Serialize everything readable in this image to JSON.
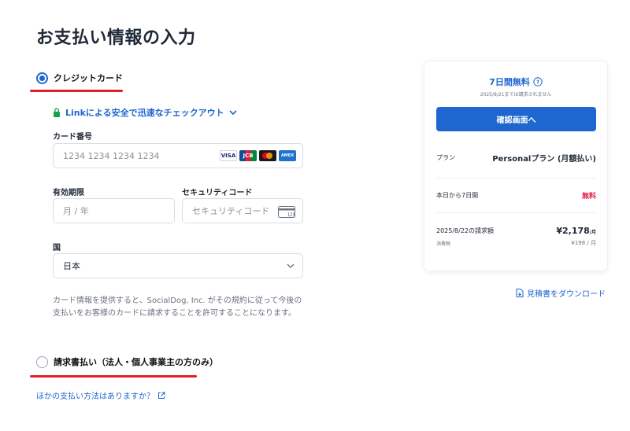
{
  "page": {
    "title": "お支払い情報の入力"
  },
  "payment_methods": {
    "credit_card": {
      "label": "クレジットカード",
      "selected": true
    },
    "invoice": {
      "label": "請求書払い（法人・個人事業主の方のみ）",
      "selected": false
    }
  },
  "link_checkout": {
    "label": "Linkによる安全で迅速なチェックアウト"
  },
  "card_form": {
    "card_number_label": "カード番号",
    "card_number_placeholder": "1234 1234 1234 1234",
    "brands": [
      "VISA",
      "JCB",
      "Mastercard",
      "AMEX"
    ],
    "expiry_label": "有効期限",
    "expiry_placeholder": "月 / 年",
    "cvc_label": "セキュリティコード",
    "cvc_placeholder": "セキュリティコード",
    "cvc_icon_text": "123",
    "country_label": "国",
    "country_value": "日本"
  },
  "disclaimer": "カード情報を提供すると、SocialDog, Inc. がその規約に従って今後の支払いをお客様のカードに請求することを許可することになります。",
  "other_methods_link": "ほかの支払い方法はありますか？",
  "summary": {
    "trial_title": "7日間無料",
    "trial_subtitle": "2025/8/21までは請求されません",
    "confirm_button": "確認画面へ",
    "plan_label": "プラン",
    "plan_value": "Personalプラン (月額払い)",
    "trial_row_label": "本日から7日間",
    "trial_row_value": "無料",
    "billing_label": "2025/8/22の請求額",
    "billing_amount": "¥2,178",
    "billing_unit": "/月",
    "tax_label": "消費税",
    "tax_value": "¥198 / 月"
  },
  "download_link": "見積書をダウンロード",
  "colors": {
    "accent": "#1e66d0",
    "highlight_underline": "#e11d2a",
    "free_text": "#e11d48"
  }
}
